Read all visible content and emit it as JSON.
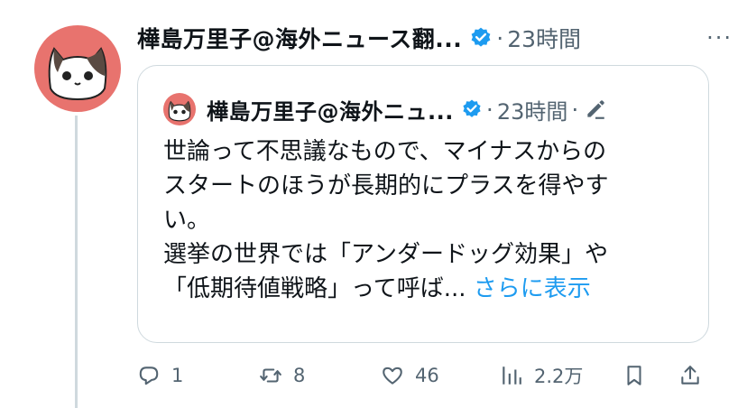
{
  "post": {
    "author_name": "樺島万里子@海外ニュース翻...",
    "dot": "·",
    "time": "23時間",
    "more": "···"
  },
  "quote": {
    "author_name": "樺島万里子@海外ニュ...",
    "dot1": "·",
    "time": "23時間",
    "dot2": "·",
    "lines": [
      "世論って不思議なもので、マイナスからの",
      "スタートのほうが長期的にプラスを得やす",
      "い。",
      "選挙の世界では「アンダードッグ効果」や",
      "「低期待値戦略」って呼ば..."
    ],
    "show_more": "さらに表示"
  },
  "actions": {
    "replies": "1",
    "reposts": "8",
    "likes": "46",
    "views": "2.2万"
  },
  "icons": {
    "verified": "verified-badge-icon",
    "edit": "edit-pencil-icon",
    "reply": "reply-icon",
    "repost": "repost-icon",
    "like": "heart-icon",
    "views": "views-icon",
    "bookmark": "bookmark-icon",
    "share": "share-icon"
  },
  "colors": {
    "accent": "#1d9bf0",
    "avatar_bg": "#e8736e",
    "secondary_text": "#536471",
    "border": "#cfd9de"
  }
}
